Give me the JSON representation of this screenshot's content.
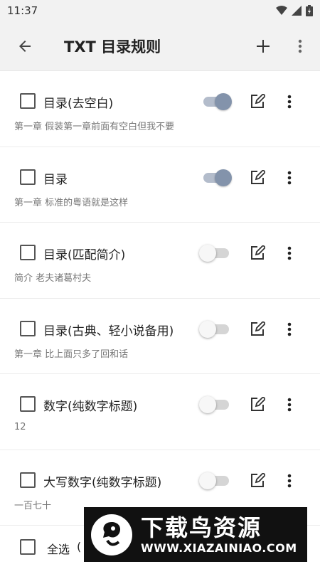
{
  "status_bar": {
    "time": "11:37"
  },
  "app_bar": {
    "title": "TXT 目录规则"
  },
  "rules": [
    {
      "name": "目录(去空白)",
      "example": "第一章 假装第一章前面有空白但我不要",
      "enabled": true
    },
    {
      "name": "目录",
      "example": "第一章 标准的粤语就是这样",
      "enabled": true
    },
    {
      "name": "目录(匹配简介)",
      "example": "简介 老夫诸葛村夫",
      "enabled": false
    },
    {
      "name": "目录(古典、轻小说备用)",
      "example": "第一章 比上面只多了回和话",
      "enabled": false
    },
    {
      "name": "数字(纯数字标题)",
      "example": "12",
      "enabled": false
    },
    {
      "name": "大写数字(纯数字标题)",
      "example": "一百七十",
      "enabled": false
    }
  ],
  "bottom_bar": {
    "select_all_label": "全选",
    "select_count": "("
  },
  "watermark": {
    "title": "下载鸟资源",
    "url": "WWW.XIAZAINIAO.COM"
  },
  "colors": {
    "toggle_on": "#8393ab",
    "background": "#f2f2f2"
  }
}
